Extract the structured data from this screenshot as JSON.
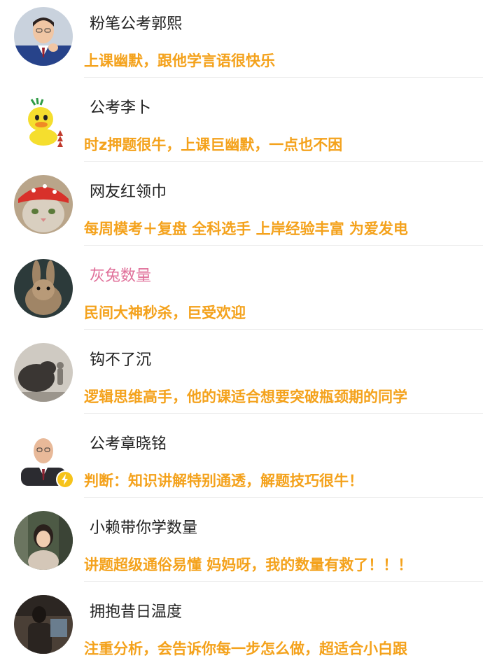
{
  "comments": [
    {
      "name": "粉笔公考郭熙",
      "text": "上课幽默，跟他学言语很快乐",
      "avatar": "man-in-suit-avatar"
    },
    {
      "name": "公考李卜",
      "text": "时z押题很牛，上课巨幽默，一点也不困",
      "avatar": "duck-cartoon-avatar"
    },
    {
      "name": "网友红领巾",
      "text": "每周模考＋复盘  全科选手  上岸经验丰富  为爱发电",
      "avatar": "cat-with-red-hat-avatar"
    },
    {
      "name": "灰兔数量",
      "text": "民间大神秒杀，巨受欢迎",
      "avatar": "rabbit-avatar"
    },
    {
      "name": "钩不了沉",
      "text": "逻辑思维高手，他的课适合想要突破瓶颈期的同学",
      "avatar": "bear-and-child-avatar"
    },
    {
      "name": "公考章晓铭",
      "text": "判断：知识讲解特别通透，解题技巧很牛！",
      "avatar": "bald-man-avatar"
    },
    {
      "name": "小赖带你学数量",
      "text": "讲题超级通俗易懂  妈妈呀，我的数量有救了！！！",
      "avatar": "woman-portrait-avatar"
    },
    {
      "name": "拥抱昔日温度",
      "text": "注重分析，会告诉你每一步怎么做，超适合小白跟",
      "avatar": "dark-photo-avatar"
    }
  ],
  "colors": {
    "comment_text": "#f4a21c",
    "name_text": "#222222",
    "highlight_name": "#e0709a",
    "verified_badge": "#f6c31a"
  }
}
